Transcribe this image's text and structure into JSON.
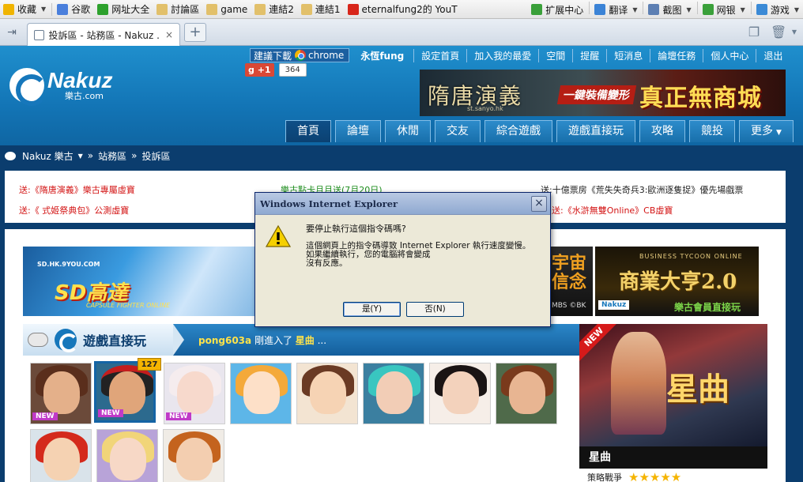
{
  "bookmarks": [
    {
      "label": "收藏",
      "color": "#f0b400",
      "caret": true
    },
    {
      "label": "谷歌",
      "color": "#4a7fdc"
    },
    {
      "label": "网址大全",
      "color": "#2da12d"
    },
    {
      "label": "討論區",
      "color": "#e2c06a"
    },
    {
      "label": "game",
      "color": "#e2c06a"
    },
    {
      "label": "連結2",
      "color": "#e2c06a"
    },
    {
      "label": "連結1",
      "color": "#e2c06a"
    },
    {
      "label": "eternalfung2的 YouT",
      "color": "#d8261a"
    }
  ],
  "bookmarks_right": [
    {
      "label": "扩展中心",
      "color": "#3aa03a"
    },
    {
      "label": "翻译",
      "color": "#3b83d6",
      "caret": true
    },
    {
      "label": "截图",
      "color": "#5d7fb3",
      "caret": true
    },
    {
      "label": "网银",
      "color": "#3aa03a",
      "caret": true
    },
    {
      "label": "游戏",
      "color": "#3b8ad6",
      "caret": true
    }
  ],
  "tab": {
    "title": "投訴區 - 站務區 - Nakuz ...",
    "close": "×",
    "new": "+"
  },
  "site": {
    "logo_name": "Nakuz",
    "logo_sub": "樂古.com",
    "download_label": "建議下載",
    "chrome_label": "chrome",
    "user": "永恆fung",
    "top_links": [
      "設定首頁",
      "加入我的最愛",
      "空間",
      "提醒",
      "短消息",
      "論壇任務",
      "個人中心",
      "退出"
    ],
    "gplus_label": "+1",
    "gplus_count": "364",
    "banner_left": "隋唐演義",
    "banner_mid": "一鍵裝備變形",
    "banner_right": "真正無商城",
    "banner_sub": "st.sanyo.hk",
    "nav": [
      {
        "label": "首頁",
        "active": true
      },
      {
        "label": "論壇"
      },
      {
        "label": "休閒"
      },
      {
        "label": "交友"
      },
      {
        "label": "綜合遊戲"
      },
      {
        "label": "遊戲直接玩"
      },
      {
        "label": "攻略"
      },
      {
        "label": "競投"
      },
      {
        "label": "更多",
        "dropdown": true
      }
    ]
  },
  "breadcrumb": {
    "home": "Nakuz 樂古",
    "items": [
      "站務區",
      "投訴區"
    ],
    "sep": "»"
  },
  "notices": {
    "r1c1": "送:《隋唐演義》樂古專屬虛寶",
    "r1c2": "樂古點卡月月送(7月20日)",
    "r1c3": "送:十億票房《荒失失奇兵3:歐洲逐隻捉》優先場戲票",
    "r2c1": "送:《 式姬祭典包》公測虛寶",
    "r2c3": "送:《水滸無雙Online》CB虛寶"
  },
  "ads": {
    "sd_url": "SD.HK.9YOU.COM",
    "sd_logo": "SD高達",
    "sd_sub": "CAPSULE FIGHTER ONLINE",
    "mid_text": "宇宙\n信念",
    "mid_sub": "MBS ©BK",
    "biz_top": "BUSINESS TYCOON ONLINE",
    "biz_title": "商業大亨2.0",
    "biz_logo": "Nakuz",
    "biz_tag": "樂古會員直接玩"
  },
  "game_strip": {
    "title": "遊戲直接玩",
    "user": "pong603a",
    "action": " 剛進入了 ",
    "game": "星曲",
    "ellipsis": " ..."
  },
  "thumb_count": "127",
  "side": {
    "new": "NEW",
    "title": "星曲",
    "name": "星曲",
    "rating_label": "策略戰爭",
    "stars": "★★★★★"
  },
  "dialog": {
    "title": "Windows Internet Explorer",
    "question": "要停止執行這個指令碼嗎?",
    "lines": [
      "這個網頁上的指令碼導致 Internet Explorer 執行速度變慢。",
      "如果繼續執行，您的電腦將會變成",
      "沒有反應。"
    ],
    "yes": "是(Y)",
    "no": "否(N)",
    "close": "×"
  }
}
